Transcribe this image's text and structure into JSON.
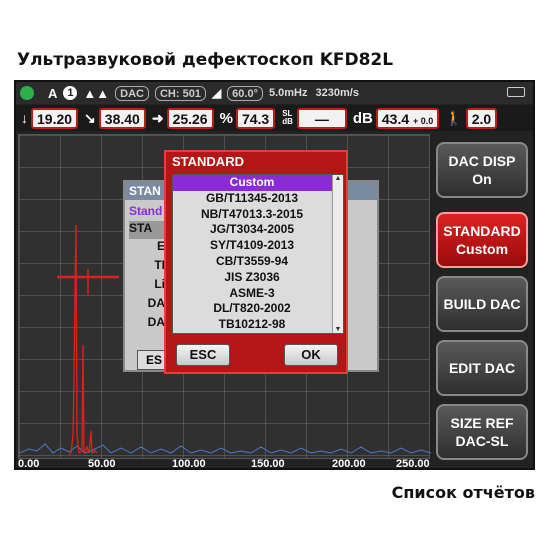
{
  "heading": "Ультразвуковой дефектоскоп KFD82L",
  "caption": "Список отчётов",
  "statusbar": {
    "mode": "A",
    "channel_num": "1",
    "dac": "DAC",
    "ch": "CH: 501",
    "angle": "60.0°",
    "freq": "5.0mHz",
    "velocity": "3230m/s"
  },
  "readings": {
    "depth": "19.20",
    "surface": "38.40",
    "projection": "25.26",
    "percent_label": "%",
    "percent": "74.3",
    "sl_label": "SL",
    "db_label_small": "dB",
    "sl_value": "—",
    "db_label": "dB",
    "gain": "43.4",
    "gain_step": "+ 0.0",
    "probe_value": "2.0"
  },
  "xaxis": [
    "0.00",
    "50.00",
    "100.00",
    "150.00",
    "200.00",
    "250.00"
  ],
  "side_buttons": [
    {
      "line1": "DAC DISP",
      "line2": "On"
    },
    {
      "line1": "STANDARD",
      "line2": "Custom"
    },
    {
      "line1": "BUILD DAC",
      "line2": ""
    },
    {
      "line1": "EDIT DAC",
      "line2": ""
    },
    {
      "line1": "SIZE REF",
      "line2": "DAC-SL"
    }
  ],
  "back_dialog": {
    "title": "STAN",
    "rows": [
      "Stand",
      "STA",
      "E",
      "TI",
      "Li",
      "DA",
      "DA"
    ],
    "esc": "ES"
  },
  "dialog": {
    "title": "STANDARD",
    "items": [
      "Custom",
      "GB/T11345-2013",
      "NB/T47013.3-2015",
      "JG/T3034-2005",
      "SY/T4109-2013",
      "CB/T3559-94",
      "JIS Z3036",
      "ASME-3",
      "DL/T820-2002",
      "TB10212-98"
    ],
    "esc": "ESC",
    "ok": "OK"
  },
  "colors": {
    "accent": "#b41616",
    "selection": "#8a2bd6",
    "status_led": "#2bb04a"
  }
}
